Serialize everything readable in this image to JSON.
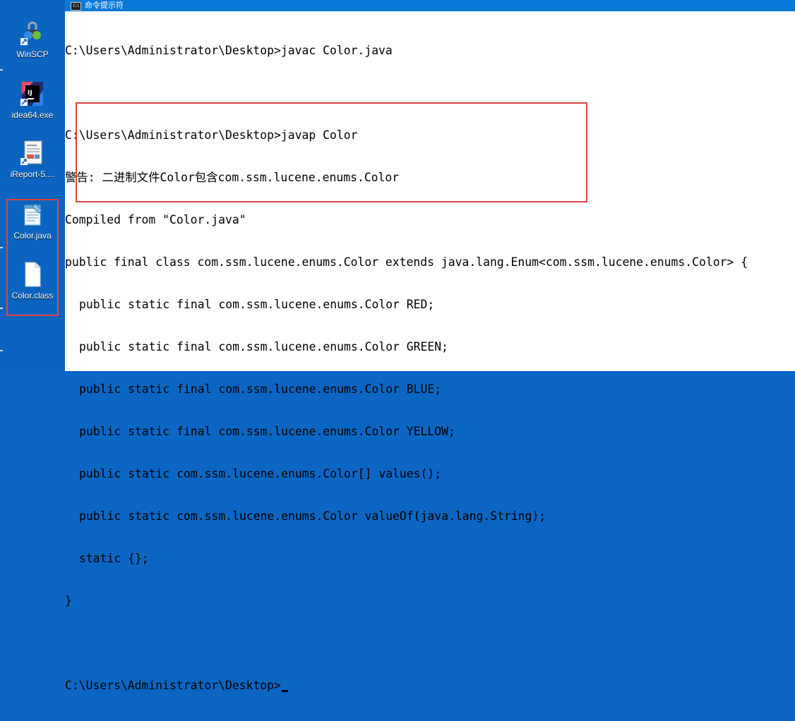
{
  "window": {
    "title": "命令提示符",
    "icon": "cmd-icon"
  },
  "desktop": {
    "icons": [
      {
        "label": "WinSCP",
        "icon": "winscp-icon"
      },
      {
        "label": "idea64.exe",
        "icon": "intellij-icon"
      },
      {
        "label": "iReport-5....",
        "icon": "ireport-icon"
      },
      {
        "label": "Color.java",
        "icon": "java-file-icon"
      },
      {
        "label": "Color.class",
        "icon": "class-file-icon"
      }
    ]
  },
  "console": {
    "lines": [
      "C:\\Users\\Administrator\\Desktop>javac Color.java",
      "",
      "C:\\Users\\Administrator\\Desktop>javap Color",
      "警告: 二进制文件Color包含com.ssm.lucene.enums.Color",
      "Compiled from \"Color.java\"",
      "public final class com.ssm.lucene.enums.Color extends java.lang.Enum<com.ssm.lucene.enums.Color> {",
      "public static final com.ssm.lucene.enums.Color RED;",
      "public static final com.ssm.lucene.enums.Color GREEN;",
      "public static final com.ssm.lucene.enums.Color BLUE;",
      "public static final com.ssm.lucene.enums.Color YELLOW;",
      "public static com.ssm.lucene.enums.Color[] values();",
      "public static com.ssm.lucene.enums.Color valueOf(java.lang.String);",
      "static {};",
      "}",
      "",
      "C:\\Users\\Administrator\\Desktop>"
    ]
  },
  "colors": {
    "desktop_bg": "#0b64bf",
    "titlebar_bg": "#0a78d7",
    "highlight_box": "#e04343"
  }
}
